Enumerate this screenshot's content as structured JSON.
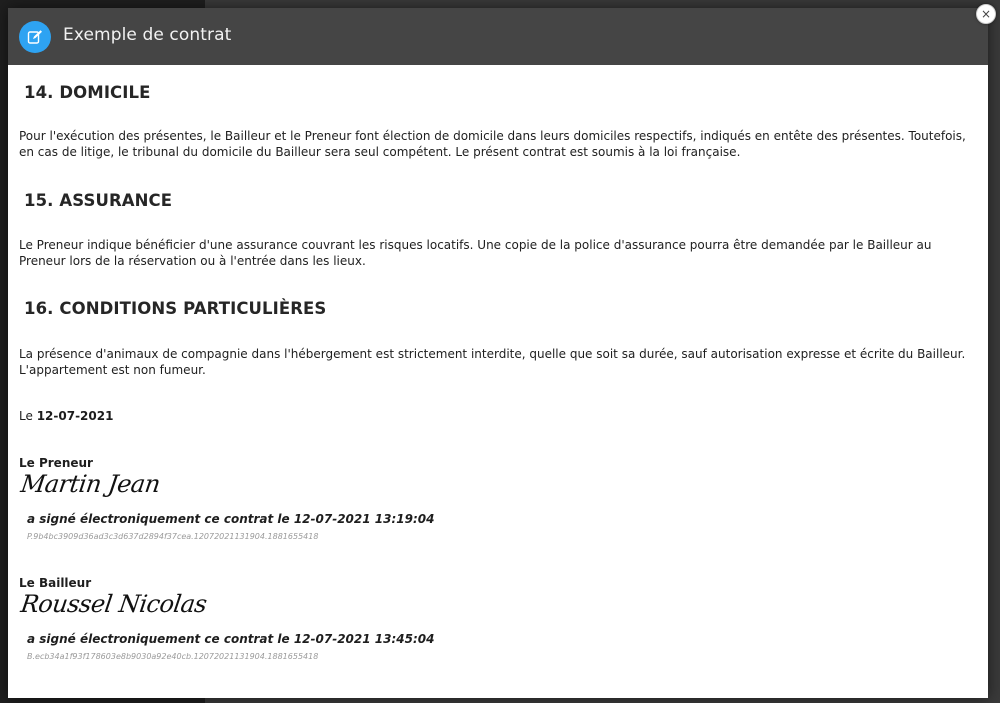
{
  "modal": {
    "title": "Exemple de contrat",
    "close_label": "×"
  },
  "sections": [
    {
      "heading": "14. DOMICILE",
      "text": "Pour l'exécution des présentes, le Bailleur et le Preneur font élection de domicile dans leurs domiciles respectifs, indiqués en entête des présentes. Toutefois, en cas de litige, le tribunal du domicile du Bailleur sera seul compétent. Le présent contrat est soumis à la loi française."
    },
    {
      "heading": "15. ASSURANCE",
      "text": "Le Preneur indique bénéficier d'une assurance couvrant les risques locatifs. Une copie de la police d'assurance pourra être demandée par le Bailleur au Preneur lors de la réservation ou à l'entrée dans les lieux."
    },
    {
      "heading": "16. CONDITIONS PARTICULIÈRES",
      "text_line1": "La présence d'animaux de compagnie dans l'hébergement est strictement interdite, quelle que soit sa durée, sauf autorisation expresse et écrite du Bailleur.",
      "text_line2": "L'appartement est non fumeur."
    }
  ],
  "date": {
    "prefix": "Le",
    "value": "12-07-2021"
  },
  "signatures": [
    {
      "role": "Le Preneur",
      "name": "Martin Jean",
      "statement": "a signé électroniquement ce contrat le 12-07-2021 13:19:04",
      "hash": "P.9b4bc3909d36ad3c3d637d2894f37cea.12072021131904.1881655418"
    },
    {
      "role": "Le Bailleur",
      "name": "Roussel Nicolas",
      "statement": "a signé électroniquement ce contrat le 12-07-2021 13:45:04",
      "hash": "B.ecb34a1f93f178603e8b9030a92e40cb.12072021131904.1881655418"
    }
  ],
  "colors": {
    "header_bg": "#454545",
    "icon_accent": "#2ea3f2"
  },
  "icons": {
    "header": "edit-icon",
    "close": "close-icon"
  }
}
